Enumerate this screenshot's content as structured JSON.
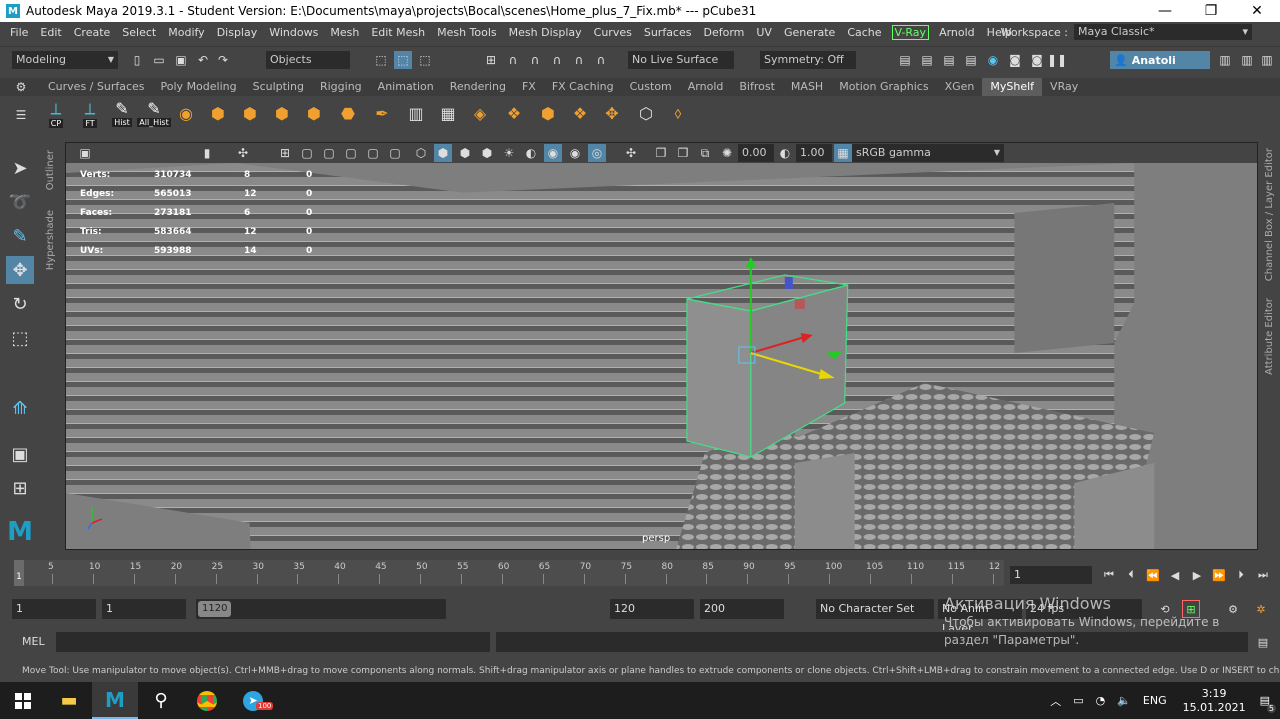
{
  "window": {
    "title": "Autodesk Maya 2019.3.1 - Student Version: E:\\Documents\\maya\\projects\\Bocal\\scenes\\Home_plus_7_Fix.mb*   ---   pCube31",
    "app_icon_letter": "M",
    "minimize": "—",
    "maximize": "❐",
    "close": "✕"
  },
  "menubar": {
    "items": [
      "File",
      "Edit",
      "Create",
      "Select",
      "Modify",
      "Display",
      "Windows",
      "Mesh",
      "Edit Mesh",
      "Mesh Tools",
      "Mesh Display",
      "Curves",
      "Surfaces",
      "Deform",
      "UV",
      "Generate",
      "Cache"
    ],
    "vray": "V-Ray",
    "items_after": [
      "Arnold",
      "Help"
    ],
    "workspace_label": "Workspace :",
    "workspace_value": "Maya Classic*"
  },
  "statusline": {
    "mode": "Modeling",
    "objects": "Objects",
    "live_surface": "No Live Surface",
    "symmetry": "Symmetry: Off",
    "user": "Anatoli"
  },
  "shelf": {
    "tabs": [
      "Curves / Surfaces",
      "Poly Modeling",
      "Sculpting",
      "Rigging",
      "Animation",
      "Rendering",
      "FX",
      "FX Caching",
      "Custom",
      "Arnold",
      "Bifrost",
      "MASH",
      "Motion Graphics",
      "XGen",
      "MyShelf",
      "VRay"
    ],
    "active_tab": "MyShelf",
    "labeled_buttons": [
      "CP",
      "FT",
      "Hist",
      "All_Hist"
    ]
  },
  "side_tabs": {
    "outliner": "Outliner",
    "hypershade": "Hypershade",
    "channel_box": "Channel Box / Layer Editor",
    "attribute_editor": "Attribute Editor"
  },
  "viewport": {
    "panel_values": {
      "exposure": "0.00",
      "gamma": "1.00",
      "colorspace": "sRGB gamma"
    },
    "hud": [
      {
        "label": "Verts:",
        "total": "310734",
        "selected": "8",
        "tris": "0"
      },
      {
        "label": "Edges:",
        "total": "565013",
        "selected": "12",
        "tris": "0"
      },
      {
        "label": "Faces:",
        "total": "273181",
        "selected": "6",
        "tris": "0"
      },
      {
        "label": "Tris:",
        "total": "583664",
        "selected": "12",
        "tris": "0"
      },
      {
        "label": "UVs:",
        "total": "593988",
        "selected": "14",
        "tris": "0"
      }
    ],
    "camera": "persp",
    "manipulator_colors": {
      "y": "#22cc22",
      "x": "#dd2222",
      "z": "#e8d800",
      "selection": "#44dd88"
    }
  },
  "timeslider": {
    "ticks": [
      "5",
      "10",
      "15",
      "20",
      "25",
      "30",
      "35",
      "40",
      "45",
      "50",
      "55",
      "60",
      "65",
      "70",
      "75",
      "80",
      "85",
      "90",
      "95",
      "100",
      "105",
      "110",
      "115",
      "12"
    ],
    "current_marker": "1",
    "current_frame": "1"
  },
  "rangeslider": {
    "start": "1",
    "playback_start": "1",
    "range_start": "1",
    "range_end": "120",
    "playback_end": "120",
    "end": "200",
    "character_set": "No Character Set",
    "anim_layer": "No Anim Layer",
    "fps": "24 fps"
  },
  "cmdline": {
    "label": "MEL"
  },
  "helpline": "Move Tool: Use manipulator to move object(s). Ctrl+MMB+drag to move components along normals. Shift+drag manipulator axis or plane handles to extrude components or clone objects. Ctrl+Shift+LMB+drag to constrain movement to a connected edge. Use D or INSERT to change the pivot position a",
  "watermark": {
    "line1": "Активация Windows",
    "line2": "Чтобы активировать Windows, перейдите в",
    "line3": "раздел \"Параметры\"."
  },
  "taskbar": {
    "language": "ENG",
    "time": "3:19",
    "date": "15.01.2021",
    "notifications": "5",
    "telegram_badge": "100"
  }
}
